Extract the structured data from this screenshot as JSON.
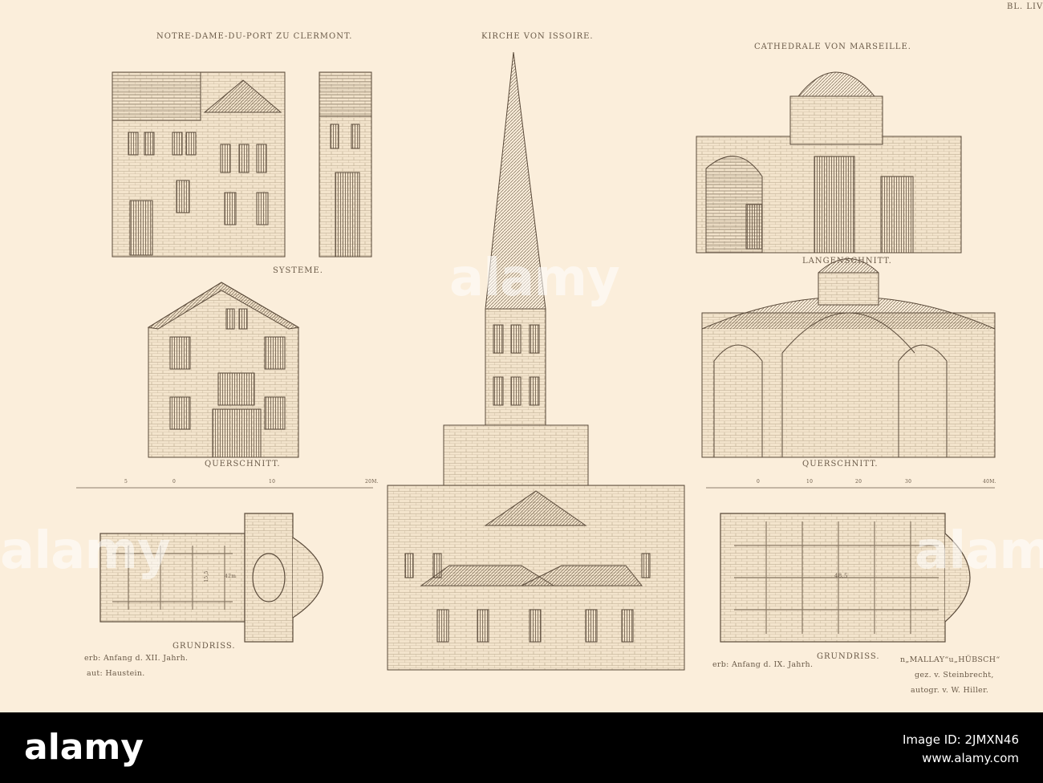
{
  "sheet": {
    "plate_number": "BL. LIV",
    "titles": {
      "clermont": "NOTRE-DAME-DU-PORT ZU CLERMONT.",
      "issoire": "KIRCHE VON ISSOIRE.",
      "marseille": "CATHEDRALE VON MARSEILLE."
    },
    "captions": {
      "systeme": "SYSTEME.",
      "langenschnitt": "LANGENSCHNITT.",
      "querschnitt_left": "QUERSCHNITT.",
      "querschnitt_right": "QUERSCHNITT.",
      "grundriss_left": "GRUNDRISS.",
      "grundriss_right": "GRUNDRISS."
    },
    "scale_left": [
      "5",
      "0",
      "10",
      "20M."
    ],
    "scale_right": [
      "0",
      "10",
      "20",
      "30",
      "40M."
    ],
    "plan_dims": {
      "left_width": "15,5",
      "left_length": "42m",
      "right": "48,5"
    },
    "notes_left": [
      "erb: Anfang d. XII. Jahrh.",
      "aut: Haustein."
    ],
    "notes_right": [
      "erb: Anfang d. IX. Jahrh."
    ],
    "credits": [
      "n„MALLAY“u„HÜBSCH“",
      "gez. v. Steinbrecht,",
      "autogr. v. W. Hiller."
    ]
  },
  "watermark": {
    "text": "alamy",
    "image_id": "Image ID: 2JMXN46",
    "url": "www.alamy.com"
  },
  "colors": {
    "paper": "#fbeedb",
    "ink": "#5a4a3a",
    "bar": "#000000"
  }
}
